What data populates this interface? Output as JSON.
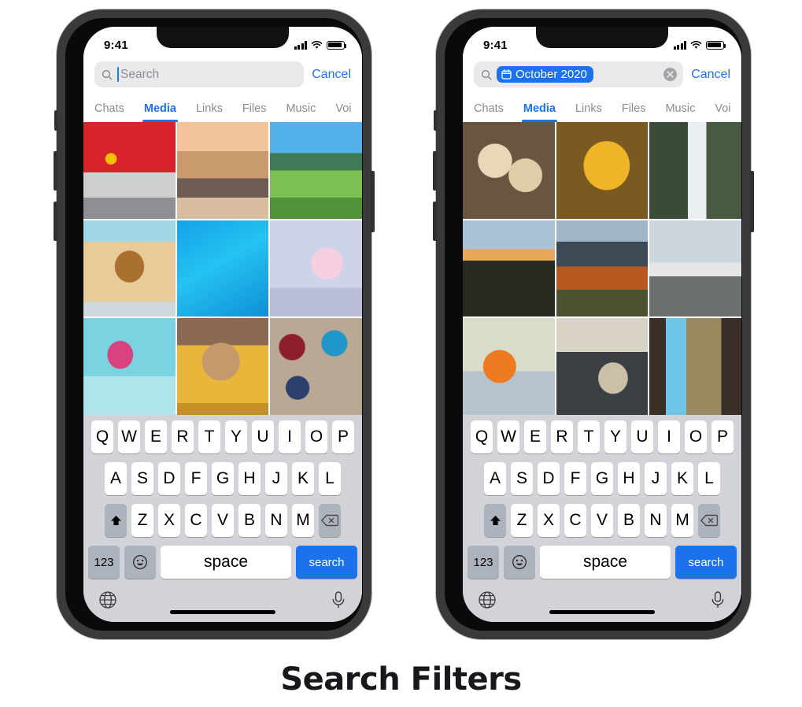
{
  "caption": "Search Filters",
  "phones": [
    {
      "id": "phone-empty-search",
      "status": {
        "time": "9:41",
        "signal_icon": "signal-bars-icon",
        "wifi_icon": "wifi-icon",
        "battery_icon": "battery-icon"
      },
      "search": {
        "icon": "magnifier-icon",
        "placeholder": "Search",
        "value": "",
        "has_caret": true,
        "has_chip": false,
        "chip_label": "",
        "chip_icon": "",
        "show_clear": false,
        "cancel_label": "Cancel"
      },
      "tabs": [
        {
          "label": "Chats",
          "active": false
        },
        {
          "label": "Media",
          "active": true
        },
        {
          "label": "Links",
          "active": false
        },
        {
          "label": "Files",
          "active": false
        },
        {
          "label": "Music",
          "active": false
        },
        {
          "label": "Voi",
          "active": false
        }
      ],
      "grid": [
        {
          "name": "photo-red-classic-car",
          "art": "p-car"
        },
        {
          "name": "photo-skateboarder-road",
          "art": "p-skate"
        },
        {
          "name": "photo-green-tea-hills",
          "art": "p-hills"
        },
        {
          "name": "photo-shiba-toast",
          "art": "p-toast"
        },
        {
          "name": "photo-legs-in-pool",
          "art": "p-pool"
        },
        {
          "name": "photo-sprinkle-donuts",
          "art": "p-donut"
        },
        {
          "name": "photo-pink-flowers-sky",
          "art": "p-flower"
        },
        {
          "name": "photo-latte-yellow-cup",
          "art": "p-coffee"
        },
        {
          "name": "photo-paint-buckets",
          "art": "p-paint"
        }
      ]
    },
    {
      "id": "phone-date-filter",
      "status": {
        "time": "9:41",
        "signal_icon": "signal-bars-icon",
        "wifi_icon": "wifi-icon",
        "battery_icon": "battery-icon"
      },
      "search": {
        "icon": "magnifier-icon",
        "placeholder": "Search",
        "value": "October 2020",
        "has_caret": false,
        "has_chip": true,
        "chip_label": "October 2020",
        "chip_icon": "calendar-icon",
        "show_clear": true,
        "cancel_label": "Cancel"
      },
      "tabs": [
        {
          "label": "Chats",
          "active": false
        },
        {
          "label": "Media",
          "active": true
        },
        {
          "label": "Links",
          "active": false
        },
        {
          "label": "Files",
          "active": false
        },
        {
          "label": "Music",
          "active": false
        },
        {
          "label": "Voi",
          "active": false
        }
      ],
      "grid": [
        {
          "name": "photo-cinnamon-rolls",
          "art": "p-rolls"
        },
        {
          "name": "photo-golden-chips",
          "art": "p-chips"
        },
        {
          "name": "photo-waterfall-ferns",
          "art": "p-falls"
        },
        {
          "name": "photo-lake-sunset",
          "art": "p-sunset"
        },
        {
          "name": "photo-autumn-mountain",
          "art": "p-mtn"
        },
        {
          "name": "photo-airport-tarmac",
          "art": "p-air"
        },
        {
          "name": "photo-child-pumpkin-head",
          "art": "p-pump"
        },
        {
          "name": "photo-pinecones-tray",
          "art": "p-pine"
        },
        {
          "name": "photo-forest-valley",
          "art": "p-valley"
        }
      ]
    }
  ],
  "keyboard": {
    "row1": [
      "Q",
      "W",
      "E",
      "R",
      "T",
      "Y",
      "U",
      "I",
      "O",
      "P"
    ],
    "row2": [
      "A",
      "S",
      "D",
      "F",
      "G",
      "H",
      "J",
      "K",
      "L"
    ],
    "row3": [
      "Z",
      "X",
      "C",
      "V",
      "B",
      "N",
      "M"
    ],
    "shift_icon": "shift-arrow-icon",
    "backspace_icon": "backspace-icon",
    "numeric_label": "123",
    "emoji_icon": "smiley-icon",
    "space_label": "space",
    "search_label": "search",
    "globe_icon": "globe-icon",
    "mic_icon": "microphone-icon"
  },
  "colors": {
    "accent_blue": "#1b72ec",
    "caret_blue": "#0a84ff",
    "tab_inactive": "#8b8b90",
    "keyboard_bg": "#d1d3d9",
    "key_bg": "#ffffff",
    "key_alt_bg": "#adb3bd",
    "search_field_bg": "#e9e9ec",
    "frame": "#3a3a3c"
  }
}
